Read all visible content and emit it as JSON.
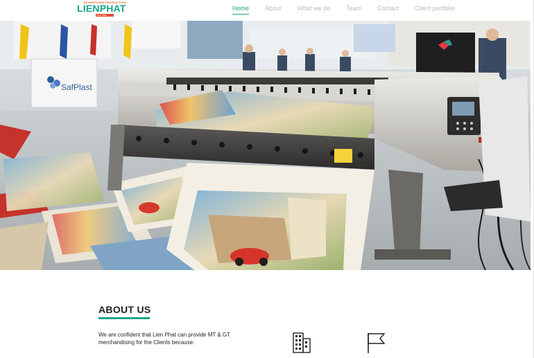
{
  "header": {
    "logo": {
      "tagline": "ADVERTISING PRODUCTION",
      "name": "LIENPHAT",
      "sub": "Since 2002",
      "colors": {
        "text": "#17a58a",
        "accent": "#e04b36"
      }
    },
    "nav": [
      {
        "label": "Home",
        "active": true
      },
      {
        "label": "About",
        "active": false
      },
      {
        "label": "What we do",
        "active": false
      },
      {
        "label": "Team",
        "active": false
      },
      {
        "label": "Contact",
        "active": false
      },
      {
        "label": "Client portfolio",
        "active": false
      }
    ]
  },
  "hero": {
    "description_icon": "large-format-printer-photo",
    "booth_sign": "SafPlast"
  },
  "about": {
    "title": "ABOUT US",
    "text": "We are confident that Lien Phat can provide MT & GT merchandising for the Clients because:",
    "icons": [
      "building-icon",
      "flag-icon"
    ]
  },
  "colors": {
    "accent": "#17a58a",
    "nav_inactive": "#b9b9b9",
    "text": "#222222"
  }
}
